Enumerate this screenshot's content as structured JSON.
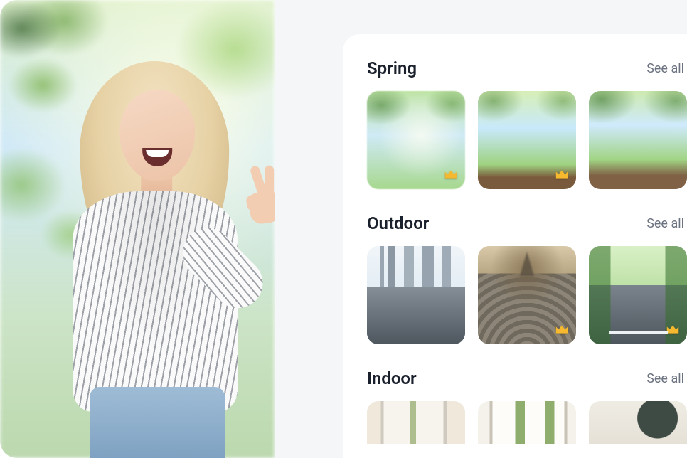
{
  "see_all_label": "See all",
  "sections": [
    {
      "title": "Spring",
      "thumbs": [
        {
          "name": "spring-foliage-blur",
          "premium": true
        },
        {
          "name": "spring-wooden-table-sky",
          "premium": true
        },
        {
          "name": "spring-bench-green-frame",
          "premium": false
        }
      ]
    },
    {
      "title": "Outdoor",
      "thumbs": [
        {
          "name": "city-street-skyline",
          "premium": true
        },
        {
          "name": "cobblestone-eiffel",
          "premium": true
        },
        {
          "name": "tree-lined-road",
          "premium": true
        }
      ]
    },
    {
      "title": "Indoor",
      "thumbs": [
        {
          "name": "window-sheer-curtains",
          "premium": false
        },
        {
          "name": "window-green-curtains",
          "premium": false
        },
        {
          "name": "minimal-wall-circle",
          "premium": false
        }
      ]
    }
  ]
}
